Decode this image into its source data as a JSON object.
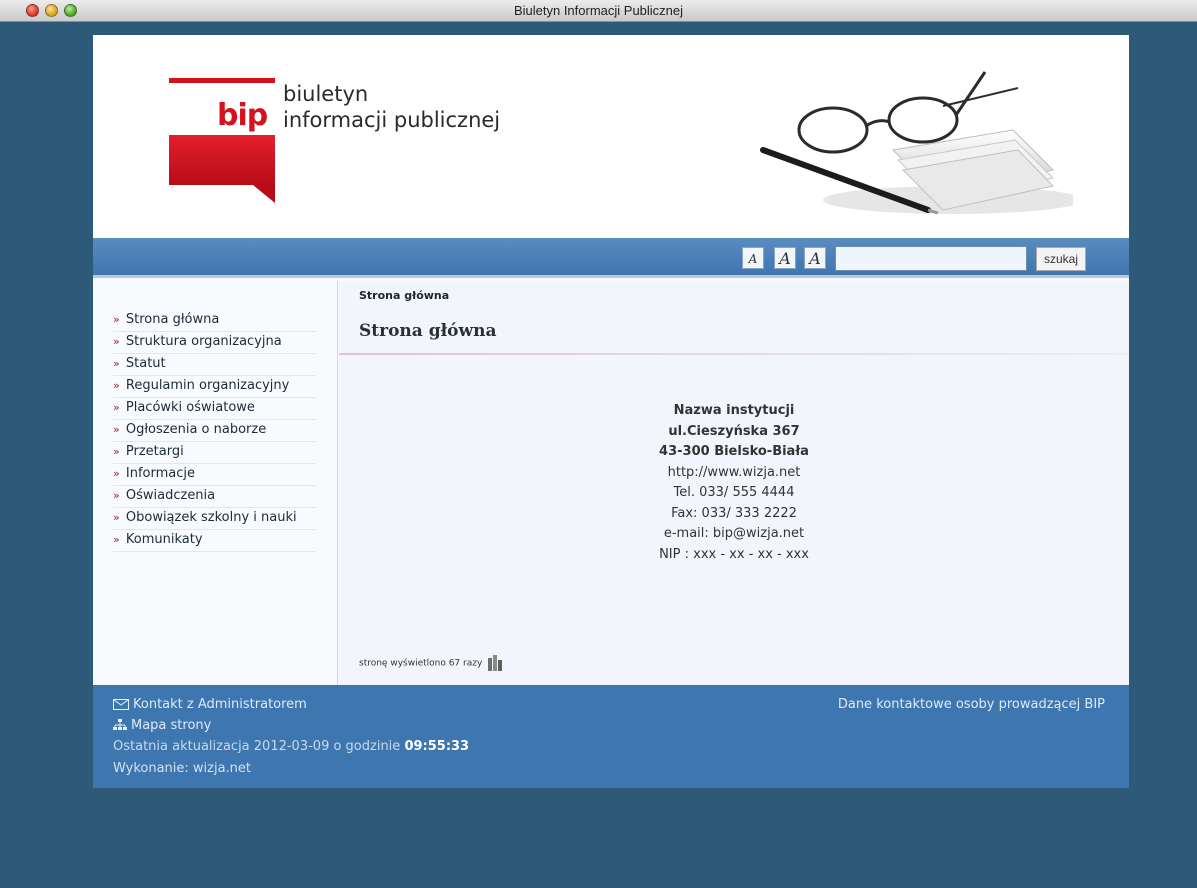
{
  "window": {
    "title": "Biuletyn Informacji Publicznej"
  },
  "header": {
    "logo_mark": "bip",
    "logo_line1": "biuletyn",
    "logo_line2": "informacji publicznej"
  },
  "toolbar": {
    "font_small": "A",
    "font_medium": "A",
    "font_large": "A",
    "search_value": "",
    "search_button": "szukaj"
  },
  "sidebar": {
    "items": [
      {
        "label": "Strona główna"
      },
      {
        "label": "Struktura organizacyjna"
      },
      {
        "label": "Statut"
      },
      {
        "label": "Regulamin organizacyjny"
      },
      {
        "label": "Placówki oświatowe"
      },
      {
        "label": "Ogłoszenia o naborze"
      },
      {
        "label": "Przetargi"
      },
      {
        "label": "Informacje"
      },
      {
        "label": "Oświadczenia"
      },
      {
        "label": "Obowiązek szkolny i nauki"
      },
      {
        "label": "Komunikaty"
      }
    ]
  },
  "main": {
    "breadcrumb": "Strona główna",
    "title": "Strona główna",
    "contact": {
      "name": "Nazwa instytucji",
      "street": "ul.Cieszyńska 367",
      "city": "43-300 Bielsko-Biała",
      "www": "http://www.wizja.net",
      "tel": "Tel. 033/ 555 4444",
      "fax": "Fax: 033/ 333 2222",
      "email": "e-mail: bip@wizja.net",
      "nip": "NIP : xxx - xx - xx - xxx"
    },
    "views_text": "stronę wyświetlono 67 razy"
  },
  "footer": {
    "contact_admin": "Kontakt z Administratorem",
    "sitemap": "Mapa strony",
    "last_update_prefix": "Ostatnia aktualizacja 2012-03-09 o godzinie",
    "last_update_time": "09:55:33",
    "made_by": "Wykonanie: wizja.net",
    "bip_contact": "Dane kontaktowe osoby prowadzącej BIP"
  },
  "colors": {
    "background": "#2d5a79",
    "accent_blue": "#3e77b0",
    "brand_red": "#d4121e"
  },
  "icons": {
    "mail": "mail-icon",
    "sitemap": "sitemap-icon",
    "stats": "bar-chart-icon"
  }
}
